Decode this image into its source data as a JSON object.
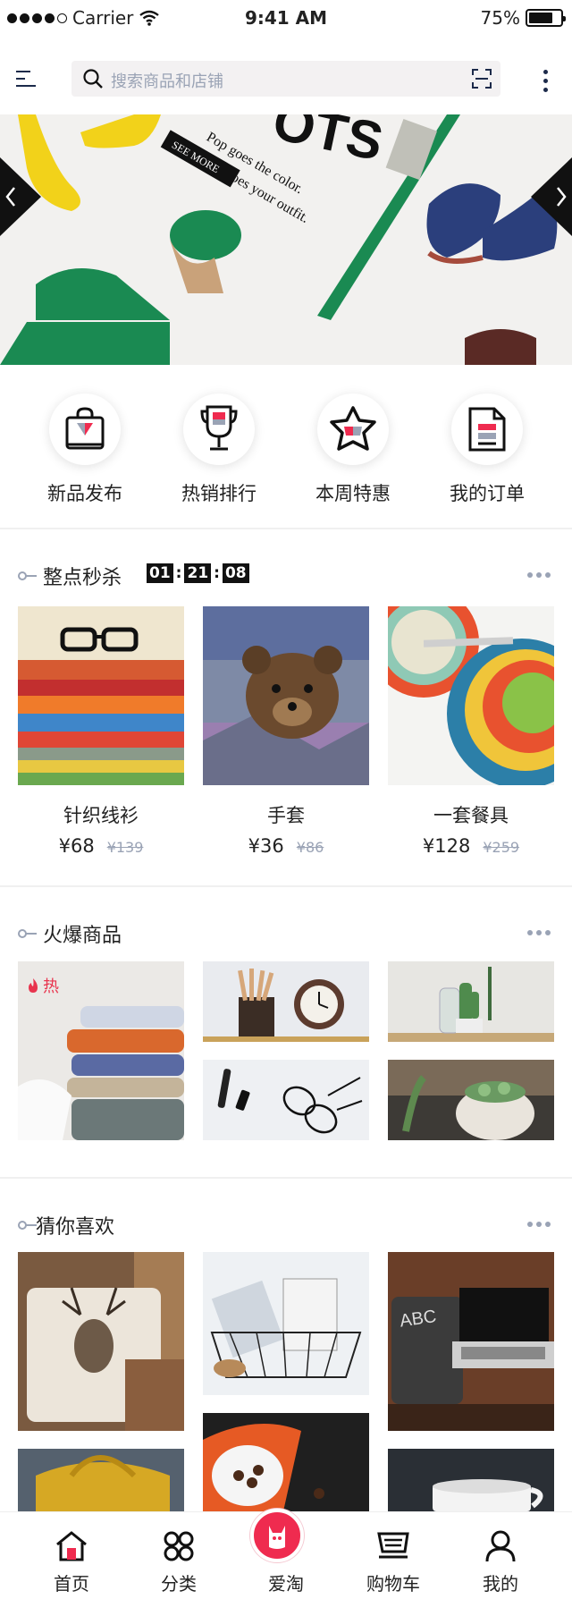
{
  "status_bar": {
    "carrier": "Carrier",
    "time": "9:41 AM",
    "battery": "75%",
    "battery_level": 0.75
  },
  "search": {
    "placeholder": "搜索商品和店铺"
  },
  "banner": {
    "text1": "Pop goes the color.",
    "text2": "Bang goes your outfit.",
    "cta": "SEE MORE",
    "headline": "OTS"
  },
  "quick_nav": [
    {
      "label": "新品发布",
      "icon": "shopping-bag-icon"
    },
    {
      "label": "热销排行",
      "icon": "trophy-icon"
    },
    {
      "label": "本周特惠",
      "icon": "star-icon"
    },
    {
      "label": "我的订单",
      "icon": "document-icon"
    }
  ],
  "flash_sale": {
    "title": "整点秒杀",
    "timer": {
      "h": "01",
      "m": "21",
      "s": "08"
    },
    "items": [
      {
        "name": "针织线衫",
        "price": "¥68",
        "old_price": "¥139"
      },
      {
        "name": "手套",
        "price": "¥36",
        "old_price": "¥86"
      },
      {
        "name": "一套餐具",
        "price": "¥128",
        "old_price": "¥259"
      }
    ]
  },
  "hot": {
    "title": "火爆商品",
    "tag": "热"
  },
  "guess": {
    "title": "猜你喜欢"
  },
  "tabbar": {
    "home": "首页",
    "category": "分类",
    "center": "爱淘",
    "cart": "购物车",
    "mine": "我的"
  },
  "colors": {
    "accent": "#ef2b4f",
    "muted": "#9aa3b5",
    "navy": "#1c2a4a"
  }
}
